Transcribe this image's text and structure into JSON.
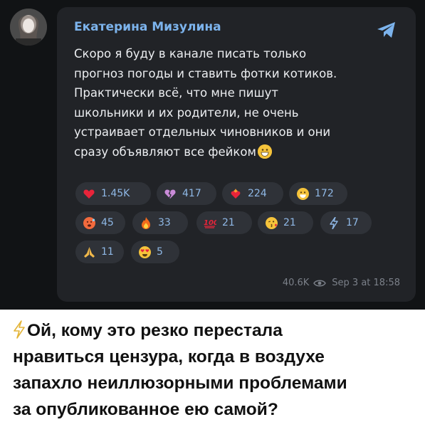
{
  "post": {
    "channel_name": "Екатерина Мизулина",
    "message_lines": [
      "Скоро я буду в канале писать только",
      "прогноз погоды и ставить фотки котиков.",
      "Практически всё, что мне пишут",
      "школьники и их родители, не очень",
      "устраивает отдельных чиновников и они",
      "сразу объявляют все фейком"
    ],
    "views": "40.6K",
    "timestamp": "Sep 3 at 18:58"
  },
  "reactions": [
    {
      "icon": "heart-icon",
      "count": "1.45K"
    },
    {
      "icon": "broken-heart-icon",
      "count": "417"
    },
    {
      "icon": "heart-on-fire-icon",
      "count": "224"
    },
    {
      "icon": "grin-face-icon",
      "count": "172"
    },
    {
      "icon": "hot-face-icon",
      "count": "45"
    },
    {
      "icon": "fire-icon",
      "count": "33"
    },
    {
      "icon": "hundred-icon",
      "count": "21"
    },
    {
      "icon": "kiss-face-icon",
      "count": "21"
    },
    {
      "icon": "lightning-icon",
      "count": "17"
    },
    {
      "icon": "pray-icon",
      "count": "11"
    },
    {
      "icon": "heart-eyes-icon",
      "count": "5"
    }
  ],
  "caption": {
    "lines": [
      "Ой, кому это резко перестала",
      "нравиться цензура, когда в воздухе",
      "запахло неиллюзорными проблемами",
      "за опубликованное ею самой?"
    ]
  },
  "colors": {
    "background": "#111315",
    "bubble": "#212327",
    "accent": "#7cb3ec",
    "reaction_chip": "#2f3238"
  }
}
